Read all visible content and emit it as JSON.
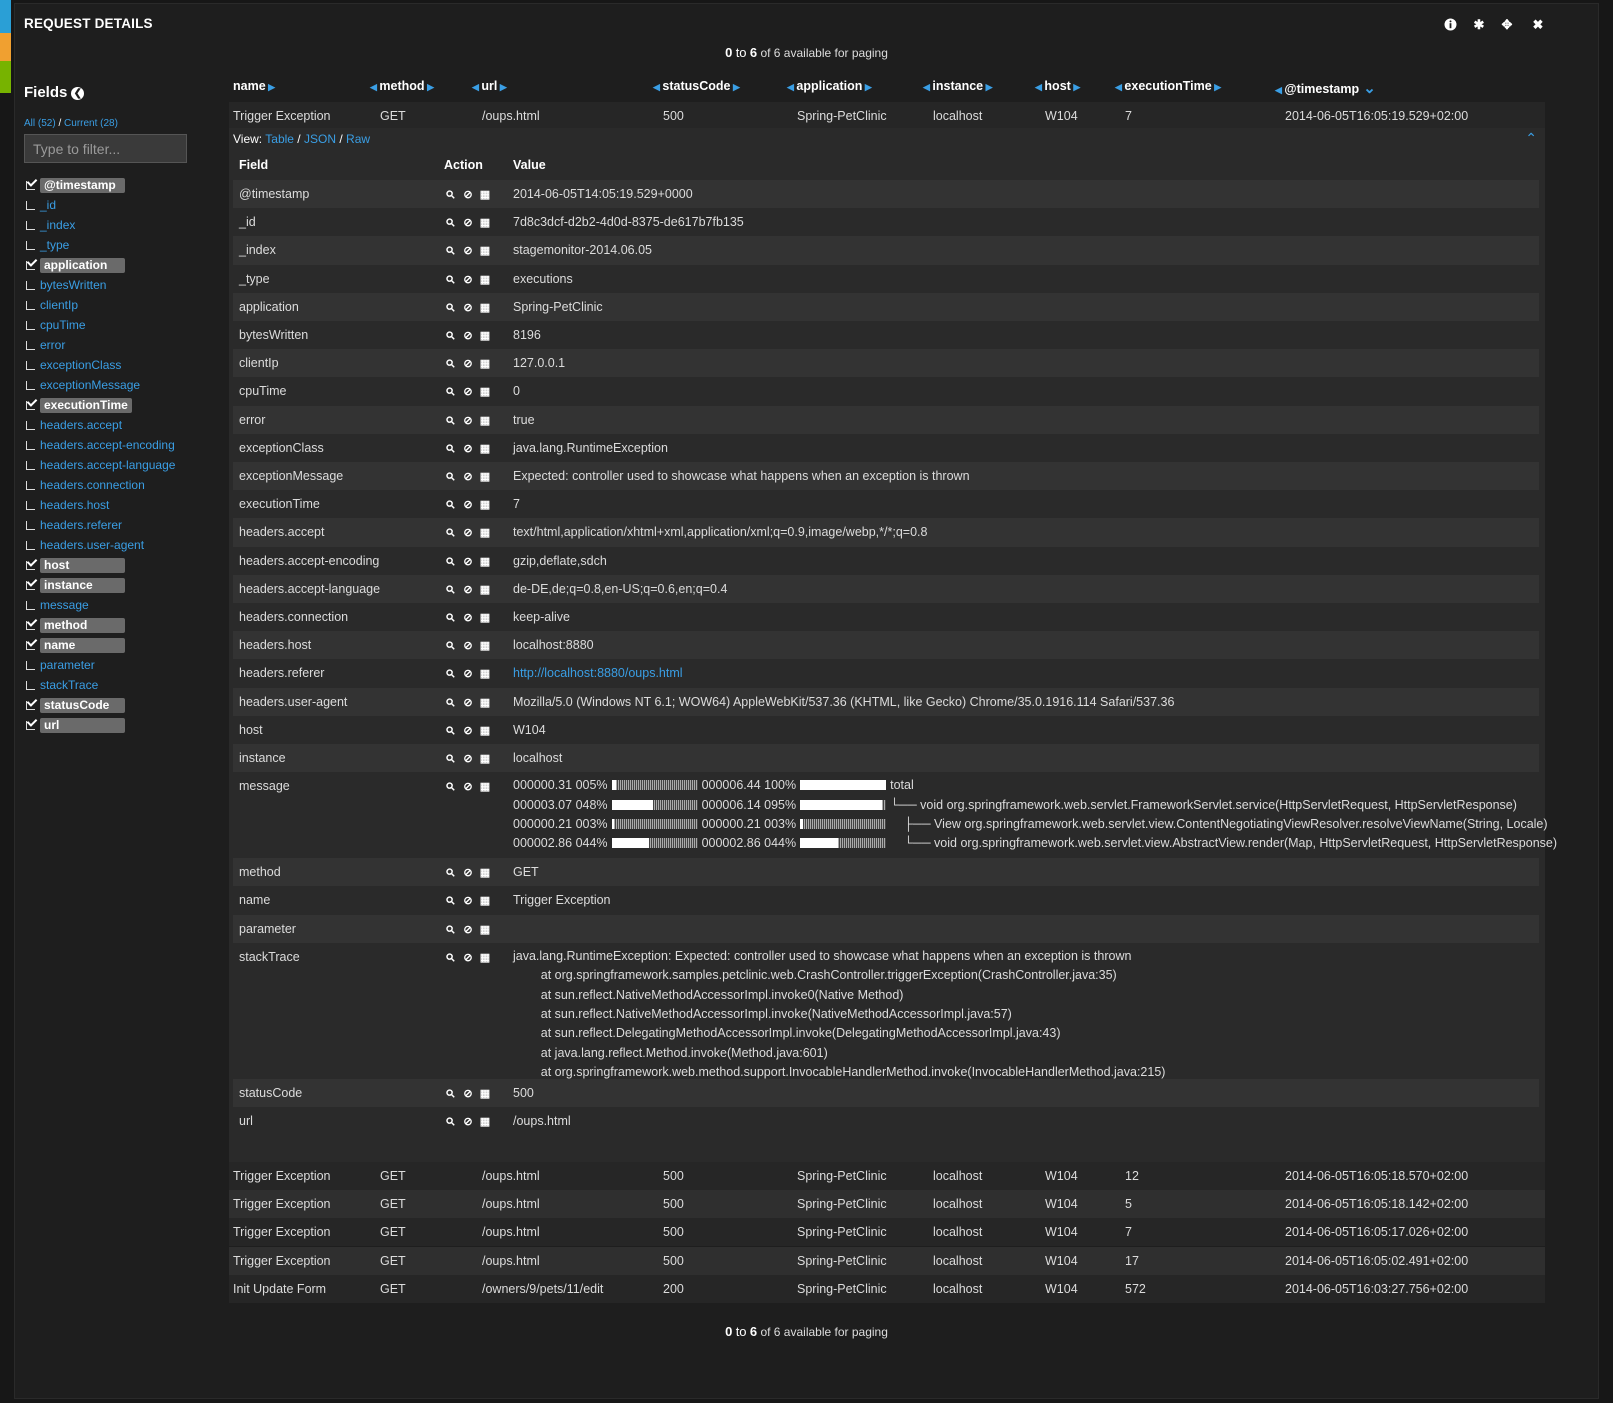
{
  "window": {
    "title": "REQUEST DETAILS"
  },
  "colors": {
    "accent": "#3a9ee4",
    "stripe_1": "#2a9fd6",
    "stripe_2": "#f0a030",
    "stripe_3": "#77b300"
  },
  "toolbar": {
    "icons": [
      "info-icon",
      "gear-icon",
      "move-icon",
      "close-icon"
    ]
  },
  "paging": {
    "from": "0",
    "to_word": "to",
    "to": "6",
    "suffix": "of 6 available for paging"
  },
  "sidebar": {
    "title": "Fields",
    "all_label": "All (52)",
    "sep": "/",
    "current_label": "Current (28)",
    "filter_placeholder": "Type to filter...",
    "fields": [
      {
        "name": "@timestamp",
        "checked": true
      },
      {
        "name": "_id",
        "checked": false
      },
      {
        "name": "_index",
        "checked": false
      },
      {
        "name": "_type",
        "checked": false
      },
      {
        "name": "application",
        "checked": true
      },
      {
        "name": "bytesWritten",
        "checked": false
      },
      {
        "name": "clientIp",
        "checked": false
      },
      {
        "name": "cpuTime",
        "checked": false
      },
      {
        "name": "error",
        "checked": false
      },
      {
        "name": "exceptionClass",
        "checked": false
      },
      {
        "name": "exceptionMessage",
        "checked": false
      },
      {
        "name": "executionTime",
        "checked": true
      },
      {
        "name": "headers.accept",
        "checked": false
      },
      {
        "name": "headers.accept-encoding",
        "checked": false
      },
      {
        "name": "headers.accept-language",
        "checked": false
      },
      {
        "name": "headers.connection",
        "checked": false
      },
      {
        "name": "headers.host",
        "checked": false
      },
      {
        "name": "headers.referer",
        "checked": false
      },
      {
        "name": "headers.user-agent",
        "checked": false
      },
      {
        "name": "host",
        "checked": true
      },
      {
        "name": "instance",
        "checked": true
      },
      {
        "name": "message",
        "checked": false
      },
      {
        "name": "method",
        "checked": true
      },
      {
        "name": "name",
        "checked": true
      },
      {
        "name": "parameter",
        "checked": false
      },
      {
        "name": "stackTrace",
        "checked": false
      },
      {
        "name": "statusCode",
        "checked": true
      },
      {
        "name": "url",
        "checked": true
      }
    ]
  },
  "table": {
    "columns": [
      {
        "label": "name",
        "left_arrow": false,
        "sort_icon": "caret-right-icon"
      },
      {
        "label": "method",
        "left_arrow": true,
        "sort_icon": "caret-right-icon"
      },
      {
        "label": "url",
        "left_arrow": true,
        "sort_icon": "caret-right-icon"
      },
      {
        "label": "statusCode",
        "left_arrow": true,
        "sort_icon": "caret-right-icon"
      },
      {
        "label": "application",
        "left_arrow": true,
        "sort_icon": "caret-right-icon"
      },
      {
        "label": "instance",
        "left_arrow": true,
        "sort_icon": "caret-right-icon"
      },
      {
        "label": "host",
        "left_arrow": true,
        "sort_icon": "caret-right-icon"
      },
      {
        "label": "executionTime",
        "left_arrow": true,
        "sort_icon": "caret-right-icon"
      },
      {
        "label": "@timestamp",
        "left_arrow": true,
        "sort_icon": "chevron-down-icon"
      }
    ],
    "rows": [
      [
        "Trigger Exception",
        "GET",
        "/oups.html",
        "500",
        "Spring-PetClinic",
        "localhost",
        "W104",
        "7",
        "2014-06-05T16:05:19.529+02:00"
      ],
      [
        "Trigger Exception",
        "GET",
        "/oups.html",
        "500",
        "Spring-PetClinic",
        "localhost",
        "W104",
        "12",
        "2014-06-05T16:05:18.570+02:00"
      ],
      [
        "Trigger Exception",
        "GET",
        "/oups.html",
        "500",
        "Spring-PetClinic",
        "localhost",
        "W104",
        "5",
        "2014-06-05T16:05:18.142+02:00"
      ],
      [
        "Trigger Exception",
        "GET",
        "/oups.html",
        "500",
        "Spring-PetClinic",
        "localhost",
        "W104",
        "7",
        "2014-06-05T16:05:17.026+02:00"
      ],
      [
        "Trigger Exception",
        "GET",
        "/oups.html",
        "500",
        "Spring-PetClinic",
        "localhost",
        "W104",
        "17",
        "2014-06-05T16:05:02.491+02:00"
      ],
      [
        "Init Update Form",
        "GET",
        "/owners/9/pets/11/edit",
        "200",
        "Spring-PetClinic",
        "localhost",
        "W104",
        "572",
        "2014-06-05T16:03:27.756+02:00"
      ]
    ]
  },
  "detail": {
    "view_label": "View:",
    "views": [
      "Table",
      "JSON",
      "Raw"
    ],
    "sep": "/",
    "collapse_icon": "chevron-up-icon",
    "headers": [
      "Field",
      "Action",
      "Value"
    ],
    "action_icons": [
      "search-icon",
      "ban-icon",
      "columns-icon"
    ],
    "fields": [
      {
        "key": "@timestamp",
        "value": "2014-06-05T14:05:19.529+0000"
      },
      {
        "key": "_id",
        "value": "7d8c3dcf-d2b2-4d0d-8375-de617b7fb135"
      },
      {
        "key": "_index",
        "value": "stagemonitor-2014.06.05"
      },
      {
        "key": "_type",
        "value": "executions"
      },
      {
        "key": "application",
        "value": "Spring-PetClinic"
      },
      {
        "key": "bytesWritten",
        "value": "8196"
      },
      {
        "key": "clientIp",
        "value": "127.0.0.1"
      },
      {
        "key": "cpuTime",
        "value": "0"
      },
      {
        "key": "error",
        "value": "true"
      },
      {
        "key": "exceptionClass",
        "value": "java.lang.RuntimeException"
      },
      {
        "key": "exceptionMessage",
        "value": "Expected: controller used to showcase what happens when an exception is thrown"
      },
      {
        "key": "executionTime",
        "value": "7"
      },
      {
        "key": "headers.accept",
        "value": "text/html,application/xhtml+xml,application/xml;q=0.9,image/webp,*/*;q=0.8"
      },
      {
        "key": "headers.accept-encoding",
        "value": "gzip,deflate,sdch"
      },
      {
        "key": "headers.accept-language",
        "value": "de-DE,de;q=0.8,en-US;q=0.6,en;q=0.4"
      },
      {
        "key": "headers.connection",
        "value": "keep-alive"
      },
      {
        "key": "headers.host",
        "value": "localhost:8880"
      },
      {
        "key": "headers.referer",
        "value": "http://localhost:8880/oups.html",
        "link": true
      },
      {
        "key": "headers.user-agent",
        "value": "Mozilla/5.0 (Windows NT 6.1; WOW64) AppleWebKit/537.36 (KHTML, like Gecko) Chrome/35.0.1916.114 Safari/537.36"
      },
      {
        "key": "host",
        "value": "W104"
      },
      {
        "key": "instance",
        "value": "localhost"
      },
      {
        "key": "message",
        "call_tree": [
          {
            "t1": "000000.31",
            "p1": "005%",
            "f1": 0.05,
            "t2": "000006.44",
            "p2": "100%",
            "f2": 1.0,
            "sig": "total"
          },
          {
            "t1": "000003.07",
            "p1": "048%",
            "f1": 0.48,
            "t2": "000006.14",
            "p2": "095%",
            "f2": 0.95,
            "sig": "└── void org.springframework.web.servlet.FrameworkServlet.service(HttpServletRequest, HttpServletResponse)"
          },
          {
            "t1": "000000.21",
            "p1": "003%",
            "f1": 0.03,
            "t2": "000000.21",
            "p2": "003%",
            "f2": 0.03,
            "sig": "    ├── View org.springframework.web.servlet.view.ContentNegotiatingViewResolver.resolveViewName(String, Locale)"
          },
          {
            "t1": "000002.86",
            "p1": "044%",
            "f1": 0.44,
            "t2": "000002.86",
            "p2": "044%",
            "f2": 0.44,
            "sig": "    └── void org.springframework.web.servlet.view.AbstractView.render(Map, HttpServletRequest, HttpServletResponse)"
          }
        ]
      },
      {
        "key": "method",
        "value": "GET"
      },
      {
        "key": "name",
        "value": "Trigger Exception"
      },
      {
        "key": "parameter",
        "value": ""
      },
      {
        "key": "stackTrace",
        "lines": [
          "java.lang.RuntimeException: Expected: controller used to showcase what happens when an exception is thrown",
          "        at org.springframework.samples.petclinic.web.CrashController.triggerException(CrashController.java:35)",
          "        at sun.reflect.NativeMethodAccessorImpl.invoke0(Native Method)",
          "        at sun.reflect.NativeMethodAccessorImpl.invoke(NativeMethodAccessorImpl.java:57)",
          "        at sun.reflect.DelegatingMethodAccessorImpl.invoke(DelegatingMethodAccessorImpl.java:43)",
          "        at java.lang.reflect.Method.invoke(Method.java:601)",
          "        at org.springframework.web.method.support.InvocableHandlerMethod.invoke(InvocableHandlerMethod.java:215)"
        ]
      },
      {
        "key": "statusCode",
        "value": "500"
      },
      {
        "key": "url",
        "value": "/oups.html"
      }
    ]
  }
}
